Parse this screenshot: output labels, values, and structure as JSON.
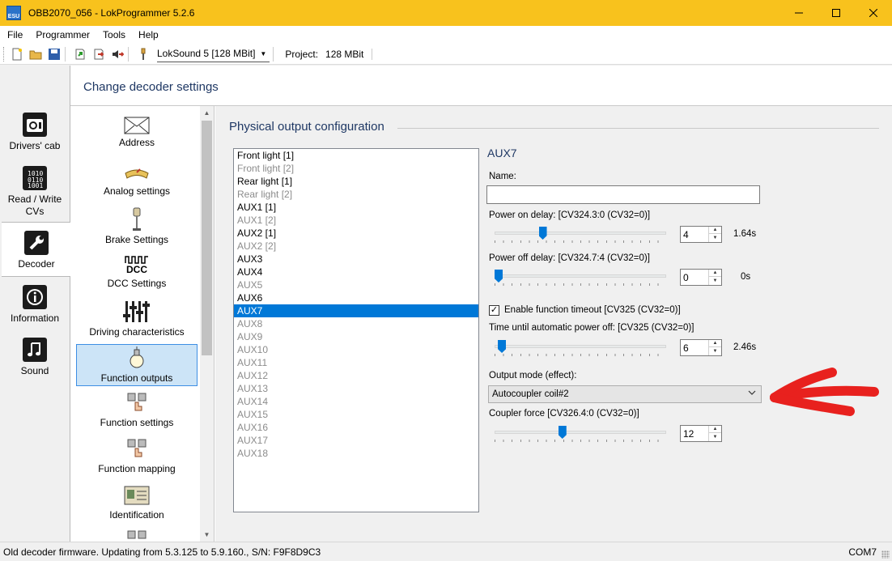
{
  "window": {
    "title": "OBB2070_056 - LokProgrammer 5.2.6",
    "app_icon_text": "ESU",
    "controls": [
      "minimize-icon",
      "maximize-icon",
      "close-icon"
    ]
  },
  "menu": [
    "File",
    "Programmer",
    "Tools",
    "Help"
  ],
  "toolbar": {
    "icons": [
      "new-file-icon",
      "open-folder-icon",
      "save-icon",
      "read-decoder-icon",
      "write-decoder-icon",
      "write-sound-icon",
      "programmer-tool-icon"
    ],
    "decoder_type": "LokSound 5 [128 MBit]",
    "project_label": "Project:",
    "project_size": "128 MBit"
  },
  "left_nav": [
    {
      "label": "Drivers' cab",
      "icon": "drivers-cab-icon",
      "active": false
    },
    {
      "label": "Read / Write CVs",
      "icon": "read-write-icon",
      "active": false
    },
    {
      "label": "Decoder",
      "icon": "wrench-icon",
      "active": true
    },
    {
      "label": "Information",
      "icon": "information-icon",
      "active": false
    },
    {
      "label": "Sound",
      "icon": "sound-icon",
      "active": false
    }
  ],
  "header": {
    "title": "Change decoder settings"
  },
  "sub_nav": [
    {
      "label": "Address",
      "icon": "envelope-icon",
      "selected": false
    },
    {
      "label": "Analog settings",
      "icon": "analog-icon",
      "selected": false
    },
    {
      "label": "Brake Settings",
      "icon": "brake-icon",
      "selected": false
    },
    {
      "label": "DCC Settings",
      "icon": "dcc-icon",
      "selected": false
    },
    {
      "label": "Driving characteristics",
      "icon": "sliders-icon",
      "selected": false
    },
    {
      "label": "Function outputs",
      "icon": "lightbulb-icon",
      "selected": true
    },
    {
      "label": "Function settings",
      "icon": "function-settings-icon",
      "selected": false
    },
    {
      "label": "Function mapping",
      "icon": "function-mapping-icon",
      "selected": false
    },
    {
      "label": "Identification",
      "icon": "id-card-icon",
      "selected": false
    }
  ],
  "dcc_icon_text": "DCC",
  "section": {
    "title": "Physical output configuration"
  },
  "outputs": [
    {
      "label": "Front light [1]",
      "dim": false
    },
    {
      "label": "Front light [2]",
      "dim": true
    },
    {
      "label": "Rear light [1]",
      "dim": false
    },
    {
      "label": "Rear light [2]",
      "dim": true
    },
    {
      "label": "AUX1 [1]",
      "dim": false
    },
    {
      "label": "AUX1 [2]",
      "dim": true
    },
    {
      "label": "AUX2 [1]",
      "dim": false
    },
    {
      "label": "AUX2 [2]",
      "dim": true
    },
    {
      "label": "AUX3",
      "dim": false
    },
    {
      "label": "AUX4",
      "dim": false
    },
    {
      "label": "AUX5",
      "dim": true
    },
    {
      "label": "AUX6",
      "dim": false
    },
    {
      "label": "AUX7",
      "dim": false,
      "selected": true
    },
    {
      "label": "AUX8",
      "dim": true
    },
    {
      "label": "AUX9",
      "dim": true
    },
    {
      "label": "AUX10",
      "dim": true
    },
    {
      "label": "AUX11",
      "dim": true
    },
    {
      "label": "AUX12",
      "dim": true
    },
    {
      "label": "AUX13",
      "dim": true
    },
    {
      "label": "AUX14",
      "dim": true
    },
    {
      "label": "AUX15",
      "dim": true
    },
    {
      "label": "AUX16",
      "dim": true
    },
    {
      "label": "AUX17",
      "dim": true
    },
    {
      "label": "AUX18",
      "dim": true
    }
  ],
  "detail": {
    "title": "AUX7",
    "name_label": "Name:",
    "name_value": "",
    "power_on": {
      "label": "Power on delay: [CV324.3:0 (CV32=0)]",
      "value": "4",
      "readout": "1.64s",
      "level": 0.27
    },
    "power_off": {
      "label": "Power off delay: [CV324.7:4 (CV32=0)]",
      "value": "0",
      "readout": "0s",
      "level": 0.0
    },
    "timeout_checkbox": {
      "label": "Enable function timeout [CV325 (CV32=0)]",
      "checked": true
    },
    "auto_off": {
      "label": "Time until automatic power off: [CV325 (CV32=0)]",
      "value": "6",
      "readout": "2.46s",
      "level": 0.02
    },
    "output_mode": {
      "label": "Output mode (effect):",
      "value": "Autocoupler coil#2"
    },
    "coupler_force": {
      "label": "Coupler force [CV326.4:0 (CV32=0)]",
      "value": "12",
      "level": 0.39
    }
  },
  "annotation": {
    "color": "#e8211e"
  },
  "status": {
    "left": "Old decoder firmware. Updating from 5.3.125 to 5.9.160., S/N: F9F8D9C3",
    "right": "COM7"
  }
}
